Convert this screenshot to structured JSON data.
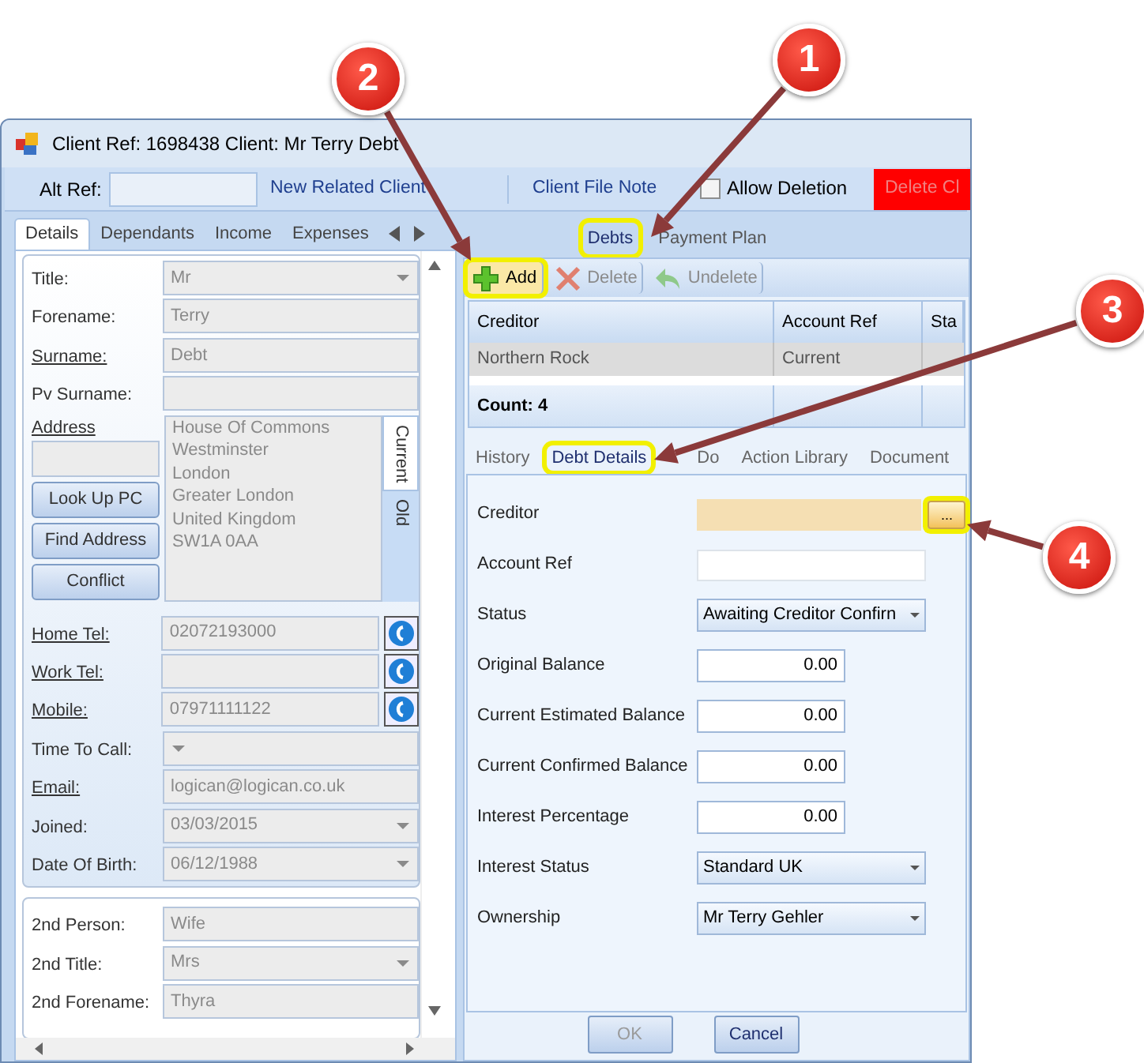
{
  "window": {
    "title": "Client Ref: 1698438 Client: Mr Terry Debt"
  },
  "toolbar": {
    "alt_ref_label": "Alt Ref:",
    "links": [
      "New Related Client",
      "Client File Note"
    ],
    "allow_deletion": {
      "label": "Allow Deletion",
      "checked": false
    },
    "delete_button": "Delete Cl"
  },
  "left_tabs": [
    {
      "label": "Details",
      "selected": true
    },
    {
      "label": "Dependants",
      "selected": false
    },
    {
      "label": "Income",
      "selected": false
    },
    {
      "label": "Expenses",
      "selected": false
    }
  ],
  "person_fields": [
    {
      "label": "Title:",
      "value": "Mr",
      "kind": "dropdown",
      "underlined": false
    },
    {
      "label": "Forename:",
      "value": "Terry",
      "kind": "text",
      "underlined": false
    },
    {
      "label": "Surname:",
      "value": "Debt",
      "kind": "text",
      "underlined": true
    },
    {
      "label": "Pv Surname:",
      "kind": "text",
      "underlined": false
    }
  ],
  "address": {
    "label": "Address",
    "buttons": [
      "Look Up PC",
      "Find Address",
      "Conflict"
    ],
    "lines": [
      "House Of Commons",
      "Westminster",
      "London",
      "Greater London",
      "United Kingdom",
      "SW1A 0AA"
    ],
    "side_tabs": [
      {
        "label": "Current",
        "selected": true
      },
      {
        "label": "Old",
        "selected": false
      }
    ]
  },
  "contact_fields": [
    {
      "label": "Home Tel:",
      "value": "02072193000",
      "kind": "phone",
      "underlined": true
    },
    {
      "label": "Work Tel:",
      "kind": "phone",
      "underlined": true
    },
    {
      "label": "Mobile:",
      "value": "07971111122",
      "kind": "phone",
      "underlined": true
    },
    {
      "label": "Time To Call:",
      "kind": "dropdown",
      "underlined": false
    },
    {
      "label": "Email:",
      "value": "logican@logican.co.uk",
      "kind": "text",
      "underlined": true
    },
    {
      "label": "Joined:",
      "value": "03/03/2015",
      "kind": "dropdown",
      "underlined": false
    },
    {
      "label": "Date Of Birth:",
      "value": "06/12/1988",
      "kind": "dropdown",
      "underlined": false
    }
  ],
  "second_person_fields": [
    {
      "label": "2nd Person:",
      "value": "Wife",
      "kind": "text",
      "underlined": false
    },
    {
      "label": "2nd Title:",
      "value": "Mrs",
      "kind": "dropdown",
      "underlined": false
    },
    {
      "label": "2nd Forename:",
      "value": "Thyra",
      "kind": "text",
      "underlined": false
    }
  ],
  "debt_tabs": [
    {
      "label": "Debts",
      "selected": true,
      "highlighted": true
    },
    {
      "label": "Payment Plan",
      "selected": false,
      "highlighted": false
    }
  ],
  "debt_toolbar": [
    {
      "label": "Add",
      "kind": "add",
      "disabled": false,
      "highlighted": true
    },
    {
      "label": "Delete",
      "kind": "delete",
      "disabled": true,
      "highlighted": false
    },
    {
      "label": "Undelete",
      "kind": "undelete",
      "disabled": true,
      "highlighted": false
    }
  ],
  "debts_table": {
    "columns": [
      "Creditor",
      "Account Ref",
      "Sta"
    ],
    "rows": [
      [
        "Northern Rock",
        "Current"
      ]
    ],
    "footer": "Count: 4"
  },
  "detail_tabs": [
    {
      "label": "History",
      "selected": false,
      "highlighted": false
    },
    {
      "label": "Debt Details",
      "selected": true,
      "highlighted": true
    },
    {
      "label": "Do",
      "selected": false,
      "highlighted": false
    },
    {
      "label": "Action Library",
      "selected": false,
      "highlighted": false
    },
    {
      "label": "Document",
      "selected": false,
      "highlighted": false
    }
  ],
  "debt_form": [
    {
      "label": "Creditor",
      "kind": "lookup",
      "button": "...",
      "highlighted": true
    },
    {
      "label": "Account Ref",
      "kind": "text"
    },
    {
      "label": "Status",
      "kind": "dropdown",
      "value": "Awaiting Creditor Confirn"
    },
    {
      "label": "Original Balance",
      "kind": "amount",
      "value": "0.00"
    },
    {
      "label": "Current Estimated Balance",
      "kind": "amount",
      "value": "0.00"
    },
    {
      "label": "Current Confirmed Balance",
      "kind": "amount",
      "value": "0.00"
    },
    {
      "label": "Interest Percentage",
      "kind": "amount",
      "value": "0.00"
    },
    {
      "label": "Interest Status",
      "kind": "dropdown",
      "value": "Standard UK"
    },
    {
      "label": "Ownership",
      "kind": "dropdown",
      "value": "Mr Terry Gehler"
    }
  ],
  "dialog_buttons": [
    {
      "label": "OK",
      "disabled": true
    },
    {
      "label": "Cancel",
      "disabled": false
    }
  ],
  "callouts": [
    "1",
    "2",
    "3",
    "4"
  ]
}
